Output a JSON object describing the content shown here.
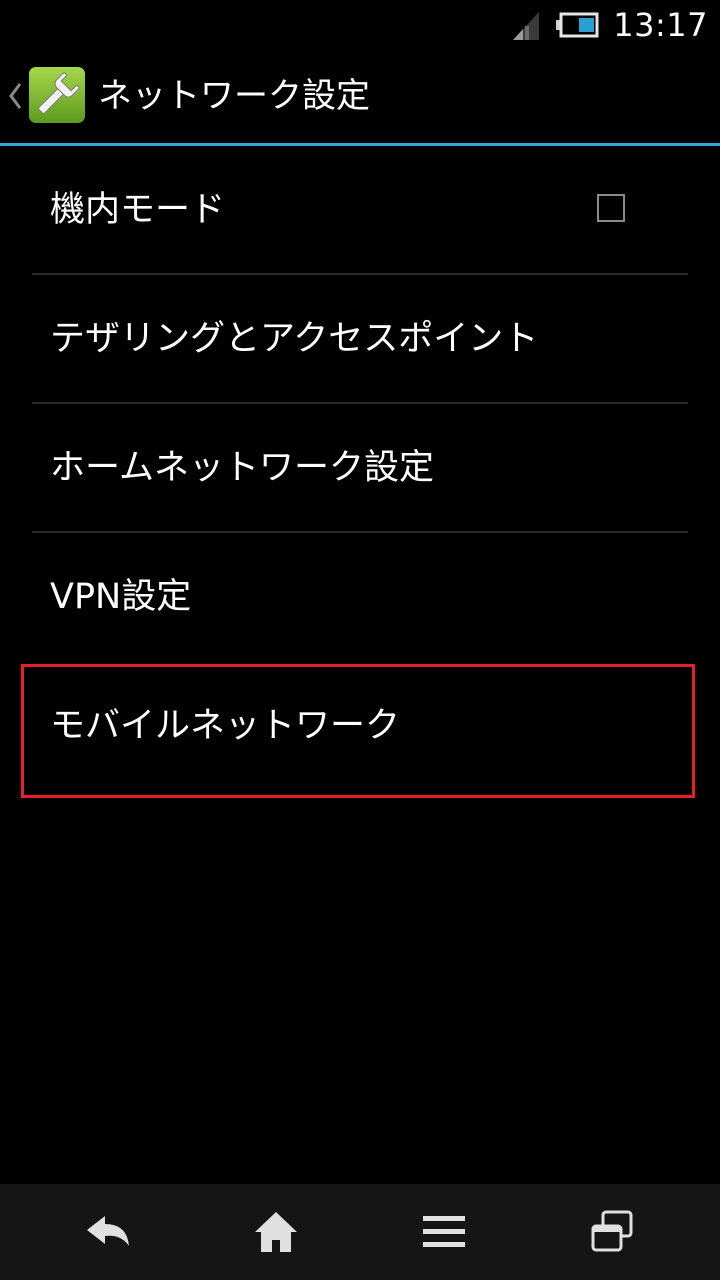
{
  "status_bar": {
    "time": "13:17",
    "signal_icon": "signal-icon",
    "battery_icon": "battery-icon"
  },
  "action_bar": {
    "title": "ネットワーク設定",
    "app_icon": "wrench-icon",
    "accent_color": "#3aa6d6"
  },
  "items": [
    {
      "label": "機内モード",
      "checkbox": true,
      "checked": false
    },
    {
      "label": "テザリングとアクセスポイント"
    },
    {
      "label": "ホームネットワーク設定"
    },
    {
      "label": "VPN設定"
    },
    {
      "label": "モバイルネットワーク",
      "highlighted": true
    }
  ],
  "highlight_color": "#e5202a",
  "nav_bar": {
    "buttons": [
      "back-icon",
      "home-icon",
      "menu-icon",
      "recent-apps-icon"
    ]
  }
}
